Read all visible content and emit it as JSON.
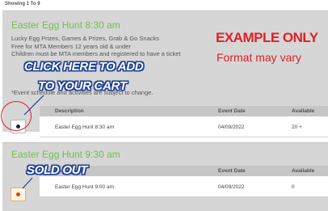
{
  "page": {
    "showing": "Showing 1 To 9"
  },
  "events": [
    {
      "title": "Easter Egg Hunt 8:30 am",
      "description": [
        "Lucky Egg Prizes, Games & Prizes, Grab & Go Snacks",
        "Free for MTA Members 12 years old & under",
        "Children must be MTA members and registered to have a ticket",
        "*Event schedule and activities are subject to change."
      ],
      "table": {
        "headers": [
          "Description",
          "Event Date",
          "Available"
        ],
        "rows": [
          {
            "description": "Easter Egg Hunt 8:30 am",
            "event_date": "04/09/2022",
            "available": "20 +"
          }
        ]
      }
    },
    {
      "title": "Easter Egg Hunt 9:30 am",
      "table": {
        "headers": [
          "Description",
          "Event Date",
          "Available"
        ],
        "rows": [
          {
            "description": "Easter Egg Hunt 9:00 am",
            "event_date": "04/09/2022",
            "available": "0"
          }
        ]
      }
    }
  ],
  "annotations": {
    "click_line1": "CLICK HERE TO ADD",
    "click_line2": "TO YOUR CART",
    "sold_out": "SOLD OUT",
    "example_only": "EXAMPLE ONLY",
    "format_note": "Format may vary"
  },
  "colors": {
    "title_green": "#6fbf4a",
    "annotation_red": "#e41e26",
    "callout_blue": "#1c3f94",
    "panel_gray": "#d6d6d6"
  }
}
